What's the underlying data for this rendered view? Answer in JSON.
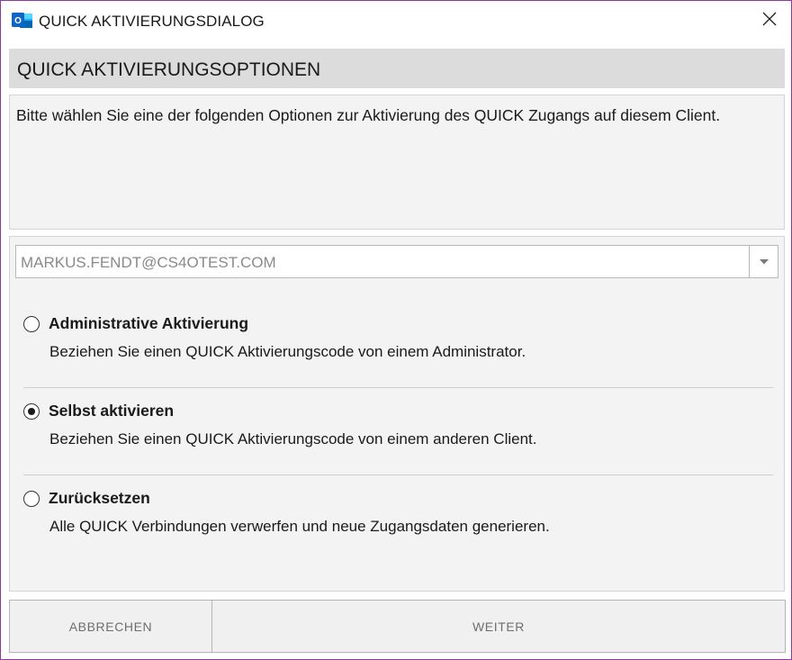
{
  "window": {
    "title": "QUICK AKTIVIERUNGSDIALOG",
    "app_icon": "outlook-icon",
    "close_icon": "close-icon"
  },
  "header": {
    "title": "QUICK AKTIVIERUNGSOPTIONEN"
  },
  "description": "Bitte wählen Sie eine der folgenden Optionen zur Aktivierung des QUICK Zugangs auf diesem Client.",
  "account_select": {
    "value": "MARKUS.FENDT@CS4OTEST.COM",
    "arrow_icon": "chevron-down-icon"
  },
  "options": [
    {
      "title": "Administrative Aktivierung",
      "description": "Beziehen Sie einen QUICK Aktivierungscode von einem Administrator.",
      "selected": false
    },
    {
      "title": "Selbst aktivieren",
      "description": "Beziehen Sie einen QUICK Aktivierungscode von einem anderen Client.",
      "selected": true
    },
    {
      "title": "Zurücksetzen",
      "description": "Alle QUICK Verbindungen verwerfen und neue Zugangsdaten generieren.",
      "selected": false
    }
  ],
  "buttons": {
    "cancel": "ABBRECHEN",
    "next": "WEITER"
  },
  "colors": {
    "window_border": "#8e3a9c",
    "header_band": "#dcdcdc",
    "panel_bg": "#f3f3f3",
    "outlook_blue": "#0f64c8"
  }
}
